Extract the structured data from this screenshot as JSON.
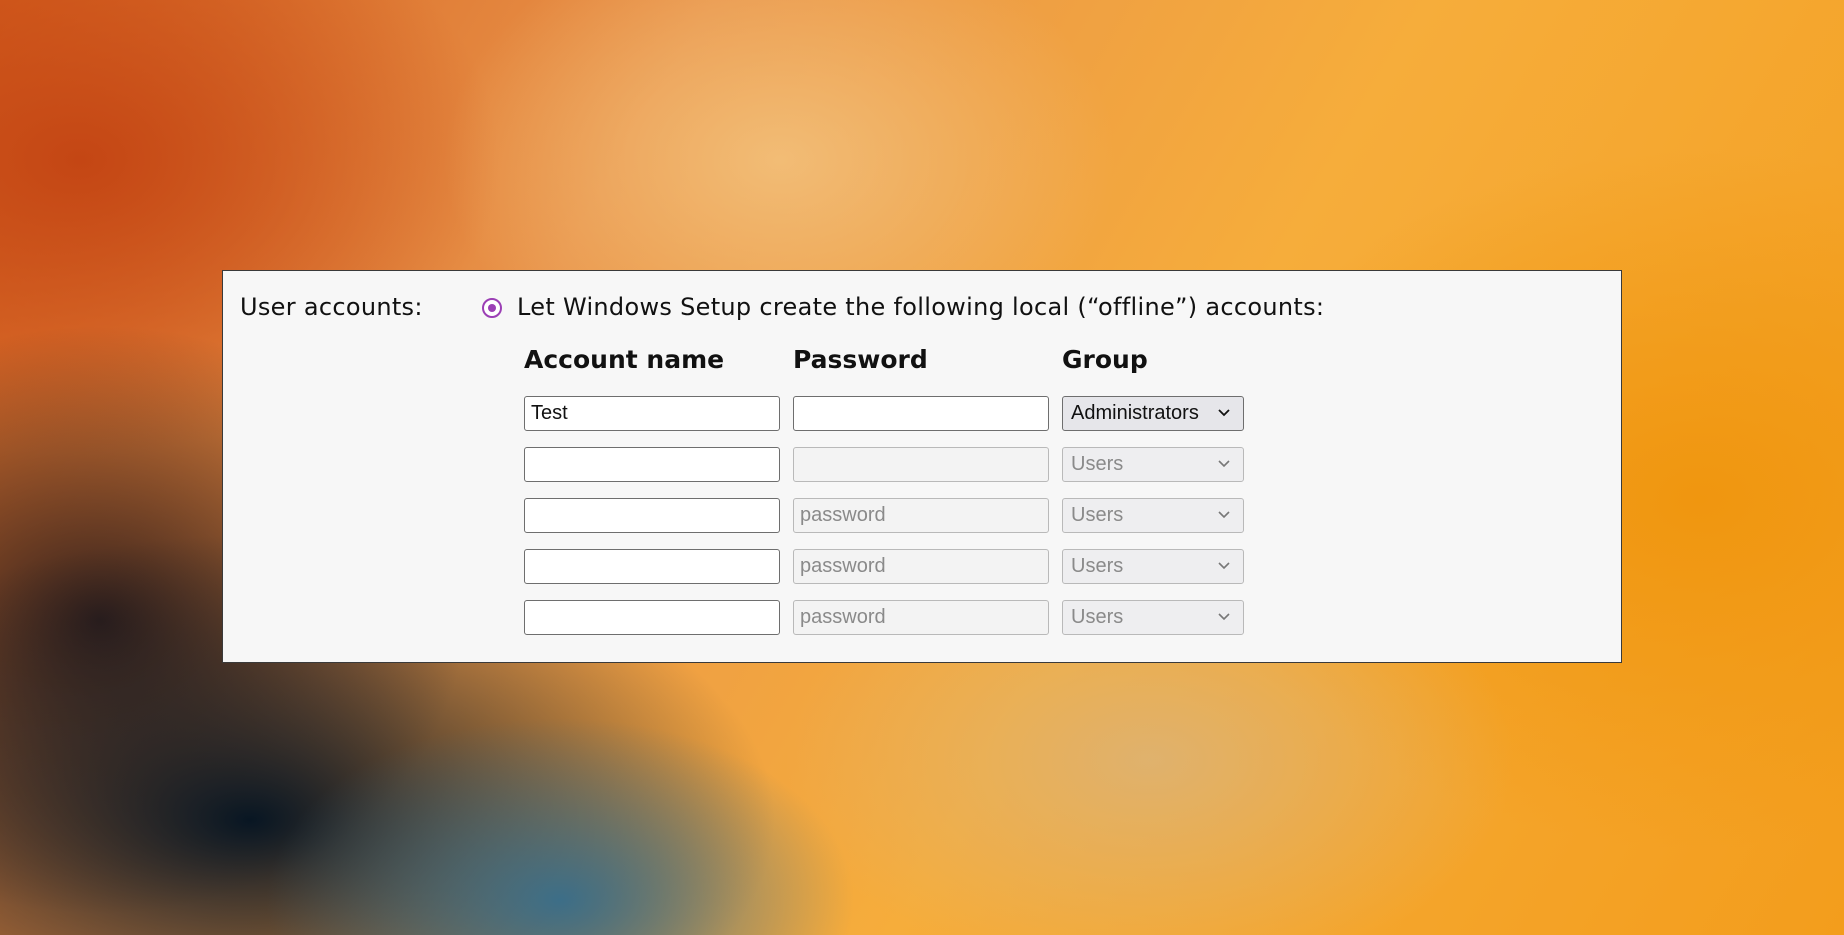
{
  "section": {
    "label": "User accounts:",
    "option_label": "Let Windows Setup create the following local (“offline”) accounts:",
    "option_selected": true
  },
  "columns": {
    "name": "Account name",
    "password": "Password",
    "group": "Group"
  },
  "rows": [
    {
      "name": "Test",
      "password": "",
      "password_placeholder": "",
      "group": "Administrators",
      "enabled": true
    },
    {
      "name": "",
      "password": "",
      "password_placeholder": "",
      "group": "Users",
      "enabled": false
    },
    {
      "name": "",
      "password": "",
      "password_placeholder": "password",
      "group": "Users",
      "enabled": false
    },
    {
      "name": "",
      "password": "",
      "password_placeholder": "password",
      "group": "Users",
      "enabled": false
    },
    {
      "name": "",
      "password": "",
      "password_placeholder": "password",
      "group": "Users",
      "enabled": false
    }
  ],
  "colors": {
    "accent": "#9b3fb5",
    "panel_bg": "#f7f7f7"
  },
  "icons": {
    "radio": "radio-selected-icon",
    "dropdown": "chevron-down-icon"
  }
}
